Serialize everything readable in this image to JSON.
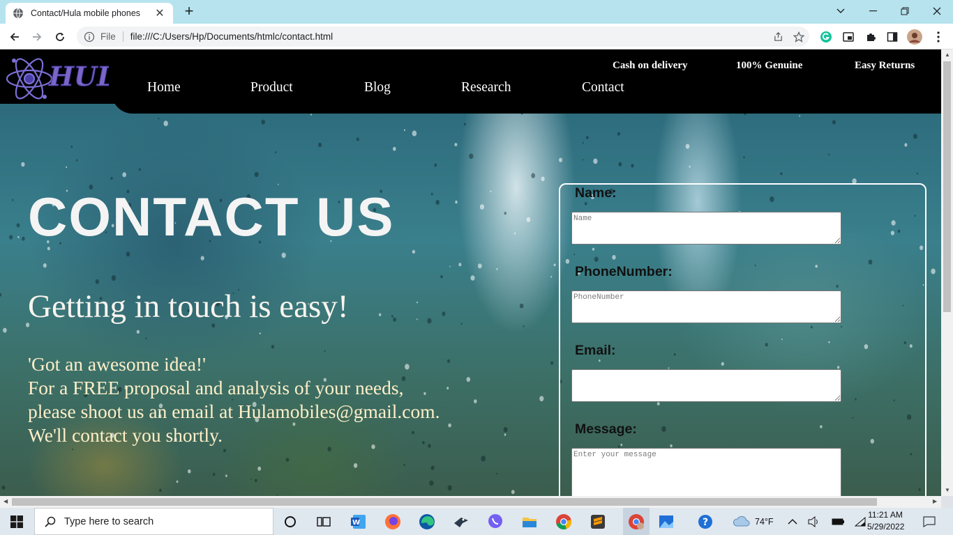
{
  "browser": {
    "tab_title": "Contact/Hula mobile phones",
    "new_tab": "+",
    "omnibox_label": "File",
    "url": "file:///C:/Users/Hp/Documents/htmlc/contact.html"
  },
  "site": {
    "logo_text": "HULA",
    "top_info": [
      "Cash on delivery",
      "100% Genuine",
      "Easy Returns"
    ],
    "nav": [
      "Home",
      "Product",
      "Blog",
      "Research",
      "Contact"
    ]
  },
  "hero": {
    "heading": "CONTACT US",
    "subheading": "Getting in touch is easy!",
    "lines": [
      "'Got an awesome idea!'",
      "For a FREE proposal and analysis of your needs,",
      "please shoot us an email at Hulamobiles@gmail.com.",
      "We'll contact you shortly."
    ]
  },
  "form": {
    "name_label": "Name:",
    "name_placeholder": "Name",
    "phone_label": "PhoneNumber:",
    "phone_placeholder": "PhoneNumber",
    "email_label": "Email:",
    "email_placeholder": "",
    "message_label": "Message:",
    "message_placeholder": "Enter your message"
  },
  "taskbar": {
    "search_placeholder": "Type here to search",
    "weather": "74°F",
    "time": "11:21 AM",
    "date": "5/29/2022"
  },
  "colors": {
    "header_bg": "#000000",
    "tab_strip": "#b6e3ee",
    "hero_text": "#ffefc8"
  }
}
